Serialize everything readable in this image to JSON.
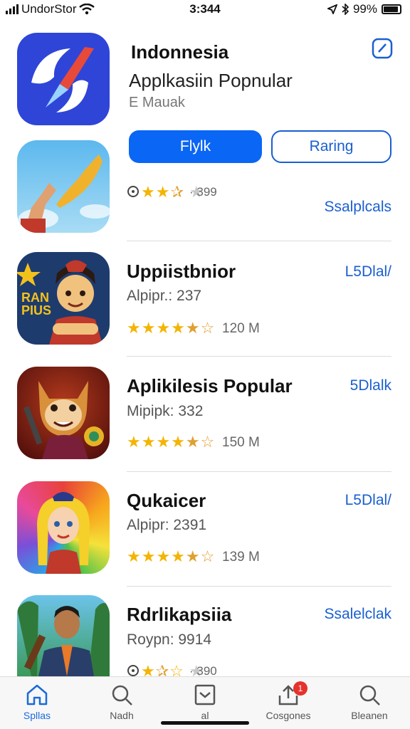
{
  "status_bar": {
    "carrier": "UndorStor",
    "time": "3:344",
    "battery": "99%"
  },
  "featured": {
    "title": "Indonnesia",
    "subtitle": "Applkasiin Popnular",
    "meta": "E Mauak",
    "primary_button": "Flylk",
    "secondary_button": "Raring",
    "rating_count": "· 399",
    "link": "Ssalplcals"
  },
  "apps": [
    {
      "title": "Uppiistbnior",
      "subtitle": "Alpipr.: 237",
      "count": "120 M",
      "price": "L5Dlal/"
    },
    {
      "title": "Aplikilesis Popular",
      "subtitle": "Mipipk: 332",
      "count": "150 M",
      "price": "5Dlalk"
    },
    {
      "title": "Qukaicer",
      "subtitle": "Alpipr: 2391",
      "count": "139 M",
      "price": "L5Dlal/"
    },
    {
      "title": "Rdrlikapsiia",
      "subtitle": "Roypn: 9914",
      "count": "· 390",
      "price": "Ssalelclak"
    }
  ],
  "tabs": [
    {
      "label": "Spllas",
      "icon": "home-icon"
    },
    {
      "label": "Nadh",
      "icon": "search-icon"
    },
    {
      "label": "al",
      "icon": "inbox-icon"
    },
    {
      "label": "Cosgones",
      "icon": "updates-icon",
      "badge": "1"
    },
    {
      "label": "Bleanen",
      "icon": "search-icon"
    }
  ],
  "colors": {
    "accent": "#0a66f5",
    "link": "#1a5fd0",
    "star": "#f4b400",
    "badge": "#e5322d"
  }
}
